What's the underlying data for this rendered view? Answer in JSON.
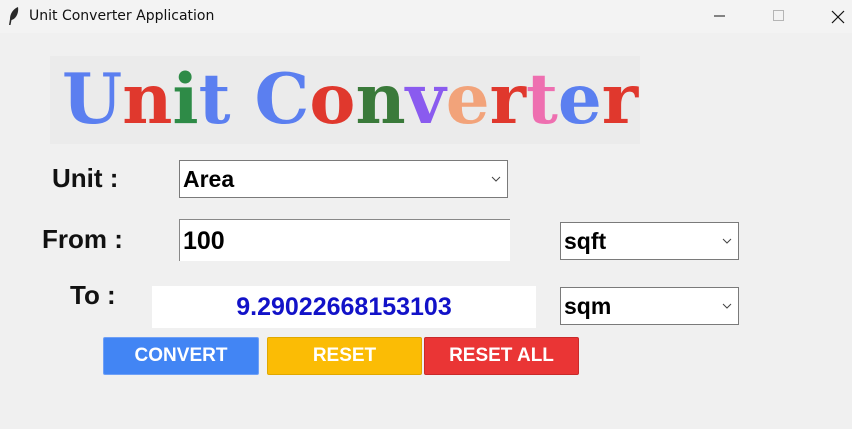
{
  "window": {
    "title": "Unit Converter Application",
    "app_icon": "feather-icon",
    "controls": [
      "minimize-icon",
      "maximize-icon",
      "close-icon"
    ]
  },
  "logo": {
    "text": "Unit Converter",
    "letters": [
      {
        "ch": "U",
        "color": "#5b7ff0"
      },
      {
        "ch": "n",
        "color": "#e0382d"
      },
      {
        "ch": "i",
        "color": "#2e8b47"
      },
      {
        "ch": "t",
        "color": "#5b7ff0"
      },
      {
        "ch": " ",
        "color": "#000000"
      },
      {
        "ch": "C",
        "color": "#5b7ff0"
      },
      {
        "ch": "o",
        "color": "#e0382d"
      },
      {
        "ch": "n",
        "color": "#3a7a3a"
      },
      {
        "ch": "v",
        "color": "#8a5bef"
      },
      {
        "ch": "e",
        "color": "#f2a37a"
      },
      {
        "ch": "r",
        "color": "#e0382d"
      },
      {
        "ch": "t",
        "color": "#ee6fb0"
      },
      {
        "ch": "e",
        "color": "#5b7ff0"
      },
      {
        "ch": "r",
        "color": "#e0382d"
      }
    ]
  },
  "form": {
    "unit_label": "Unit :",
    "unit_value": "Area",
    "from_label": "From :",
    "from_value": "100",
    "from_unit": "sqft",
    "to_label": "To :",
    "to_value": "9.29022668153103",
    "to_unit": "sqm"
  },
  "buttons": {
    "convert": "CONVERT",
    "reset": "RESET",
    "reset_all": "RESET ALL"
  },
  "colors": {
    "convert": "#4285f4",
    "reset": "#fbbc05",
    "reset_all": "#ea3535",
    "result_text": "#1212c8"
  }
}
